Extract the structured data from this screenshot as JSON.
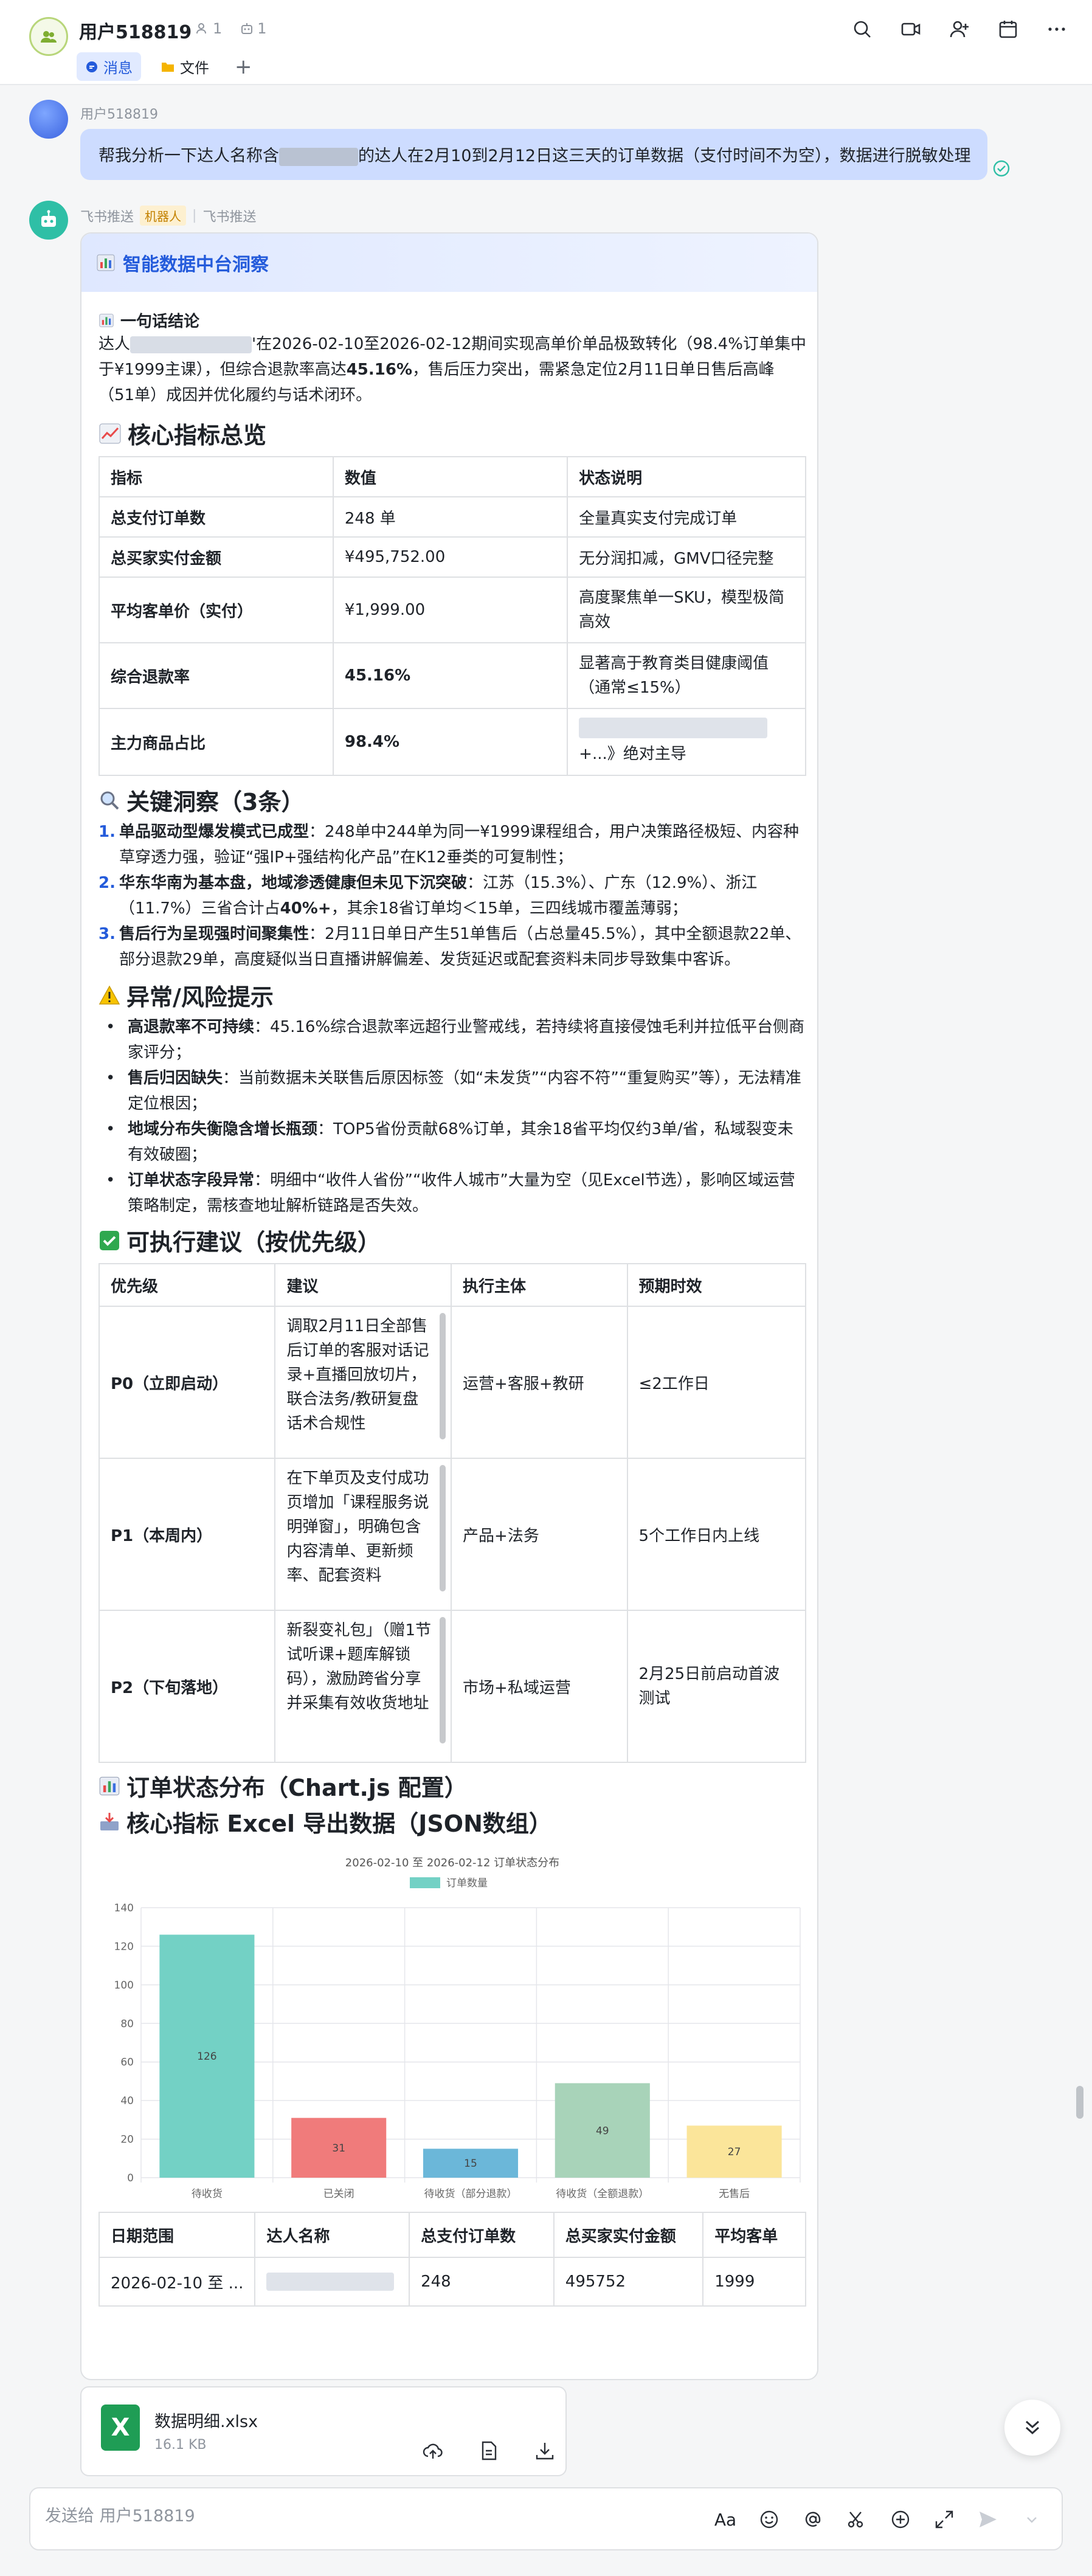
{
  "header": {
    "title": "用户518819",
    "member_count": "1",
    "bot_count": "1",
    "tabs": [
      {
        "label": "消息",
        "active": true
      },
      {
        "label": "文件",
        "active": false
      }
    ],
    "add_tab": "+"
  },
  "user_message": {
    "sender": "用户518819",
    "text_before": "帮我分析一下达人名称含",
    "text_after": "的达人在2月10到2月12日这三天的订单数据（支付时间不为空），数据进行脱敏处理"
  },
  "bot_message": {
    "sender": "飞书推送",
    "badge": "机器人",
    "source": "飞书推送"
  },
  "card": {
    "title": "智能数据中台洞察",
    "conclusion_title": "一句话结论",
    "conclusion_p1": "达人",
    "conclusion_p2": "'在2026-02-10至2026-02-12期间实现高单价单品极致转化（98.4%订单集中于¥1999主课），但综合退款率高达",
    "conclusion_bold": "45.16%",
    "conclusion_p3": "，售后压力突出，需紧急定位2月11日单日售后高峰（51单）成因并优化履约与话术闭环。",
    "kpi_title": "核心指标总览",
    "kpi_headers": [
      "指标",
      "数值",
      "状态说明"
    ],
    "kpi_rows": [
      {
        "metric": "总支付订单数",
        "value": "248 单",
        "note": "全量真实支付完成订单"
      },
      {
        "metric": "总买家实付金额",
        "value": "¥495,752.00",
        "note": "无分润扣减，GMV口径完整"
      },
      {
        "metric": "平均客单价（实付）",
        "value": "¥1,999.00",
        "note": "高度聚焦单一SKU，模型极简高效"
      },
      {
        "metric": "综合退款率",
        "value": "45.16%",
        "note": "显著高于教育类目健康阈值（通常≤15%）"
      },
      {
        "metric": "主力商品占比",
        "value": "98.4%",
        "note": "+...》绝对主导"
      }
    ],
    "insight_title": "关键洞察（3条）",
    "insights": [
      {
        "num": "1.",
        "bold": "单品驱动型爆发模式已成型",
        "text": "：248单中244单为同一¥1999课程组合，用户决策路径极短、内容种草穿透力强，验证“强IP+强结构化产品”在K12垂类的可复制性；"
      },
      {
        "num": "2.",
        "bold": "华东华南为基本盘，地域渗透健康但未见下沉突破",
        "text": "：江苏（15.3%）、广东（12.9%）、浙江（11.7%）三省合计占",
        "bold2": "40%+",
        "text2": "，其余18省订单均＜15单，三四线城市覆盖薄弱；"
      },
      {
        "num": "3.",
        "bold": "售后行为呈现强时间聚集性",
        "text": "：2月11日单日产生51单售后（占总量45.5%），其中全额退款22单、部分退款29单，高度疑似当日直播讲解偏差、发货延迟或配套资料未同步导致集中客诉。"
      }
    ],
    "risk_title": "异常/风险提示",
    "risks": [
      {
        "bold": "高退款率不可持续",
        "text": "：45.16%综合退款率远超行业警戒线，若持续将直接侵蚀毛利并拉低平台侧商家评分；"
      },
      {
        "bold": "售后归因缺失",
        "text": "：当前数据未关联售后原因标签（如“未发货”“内容不符”“重复购买”等），无法精准定位根因；"
      },
      {
        "bold": "地域分布失衡隐含增长瓶颈",
        "text": "：TOP5省份贡献68%订单，其余18省平均仅约3单/省，私域裂变未有效破圈；"
      },
      {
        "bold": "订单状态字段异常",
        "text": "：明细中“收件人省份”“收件人城市”大量为空（见Excel节选），影响区域运营策略制定，需核查地址解析链路是否失效。"
      }
    ],
    "sugg_title": "可执行建议（按优先级）",
    "sugg_headers": [
      "优先级",
      "建议",
      "执行主体",
      "预期时效"
    ],
    "sugg_rows": [
      {
        "priority": "P0（立即启动）",
        "advice": "调取2月11日全部售后订单的客服对话记录+直播回放切片，联合法务/教研复盘话术合规性",
        "owner": "运营+客服+教研",
        "eta": "≤2工作日"
      },
      {
        "priority": "P1（本周内）",
        "advice": "在下单页及支付成功页增加「课程服务说明弹窗」，明确包含内容清单、更新频率、配套资料",
        "owner": "产品+法务",
        "eta": "5个工作日内上线"
      },
      {
        "priority": "P2（下旬落地）",
        "advice": "新裂变礼包」（赠1节试听课+题库解锁码），激励跨省分享并采集有效收货地址",
        "owner": "市场+私域运营",
        "eta": "2月25日前启动首波测试"
      }
    ],
    "chart_section_title": "订单状态分布（Chart.js 配置）",
    "export_section_title": "核心指标 Excel 导出数据（JSON数组）",
    "export_headers": [
      "日期范围",
      "达人名称",
      "总支付订单数",
      "总买家实付金额",
      "平均客单"
    ],
    "export_row": [
      "2026-02-10 至 ...",
      "",
      "248",
      "495752",
      "1999"
    ]
  },
  "chart_data": {
    "type": "bar",
    "title": "2026-02-10 至 2026-02-12 订单状态分布",
    "legend": "订单数量",
    "legend_position": "top",
    "categories": [
      "待收货",
      "已关闭",
      "待收货（部分退款）",
      "待收货（全额退款）",
      "无售后"
    ],
    "values": [
      126,
      31,
      15,
      49,
      27
    ],
    "colors": [
      "#73d1c5",
      "#f07b7b",
      "#6bb7d9",
      "#a8d3b9",
      "#fbe59a"
    ],
    "ylim": [
      0,
      140
    ],
    "yticks": [
      0,
      20,
      40,
      60,
      80,
      100,
      120,
      140
    ],
    "grid": true
  },
  "file": {
    "name": "数据明细.xlsx",
    "size": "16.1 KB"
  },
  "composer": {
    "placeholder": "发送给 用户518819",
    "font_label": "Aa"
  },
  "colors": {
    "accent": "#245bdb",
    "bubble": "#cddcff",
    "bot_avatar": "#2fbfa6"
  }
}
